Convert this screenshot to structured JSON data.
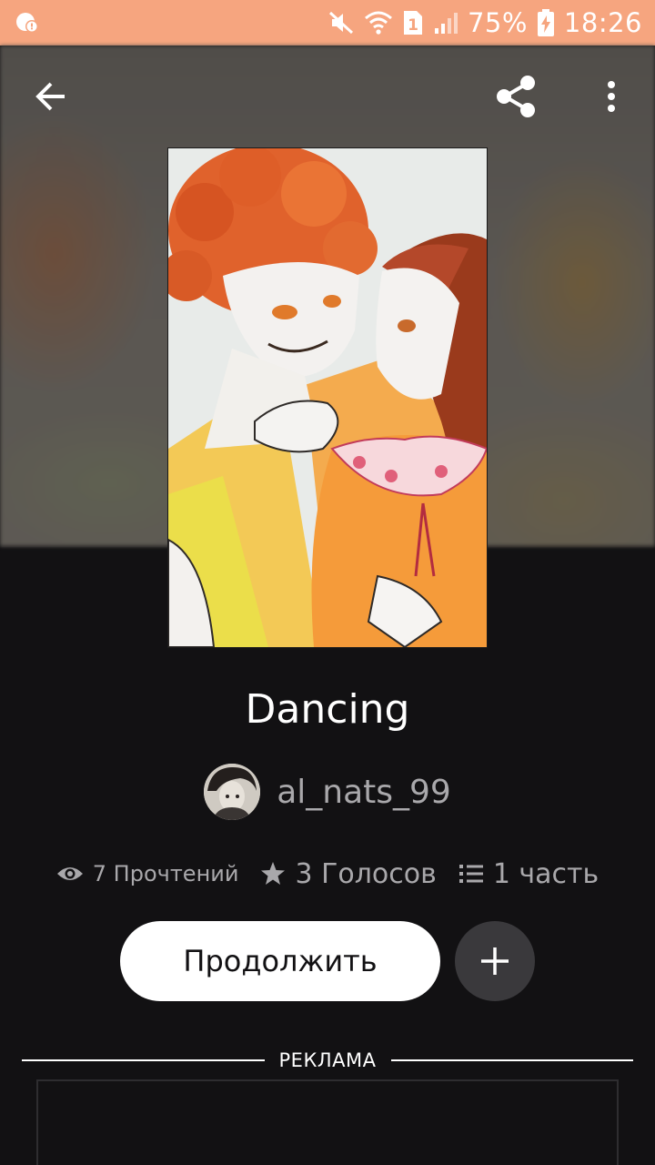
{
  "status_bar": {
    "battery": "75%",
    "time": "18:26",
    "sim_slot": "1",
    "icons": [
      "notification-icon",
      "mute-icon",
      "wifi-icon",
      "sim-icon",
      "signal-icon",
      "battery-charging-icon"
    ]
  },
  "header": {
    "back_icon": "arrow-left-icon",
    "share_icon": "share-icon",
    "more_icon": "more-vertical-icon"
  },
  "story": {
    "title": "Dancing",
    "author": "al_nats_99",
    "reads": "7 Прочтений",
    "votes": "3 Голосов",
    "parts": "1 часть"
  },
  "actions": {
    "continue_label": "Продолжить",
    "add_icon": "plus-icon"
  },
  "ad": {
    "label": "РЕКЛАМА"
  },
  "colors": {
    "status_bar": "#f6a57f",
    "background": "#121113",
    "muted_text": "#a9a8ab",
    "button_bg": "#ffffff",
    "add_button_bg": "#3a393c"
  }
}
